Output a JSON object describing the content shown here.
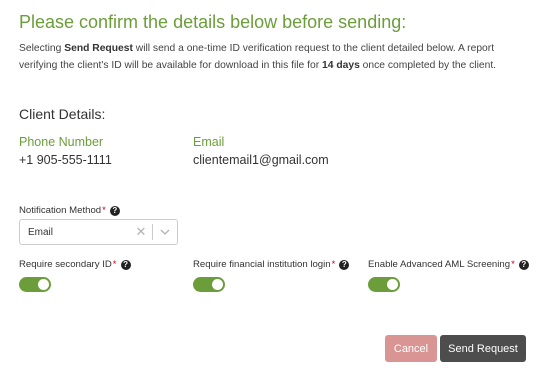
{
  "dialog": {
    "heading": "Please confirm the details below before sending:",
    "intro": {
      "part1": "Selecting ",
      "bold1": "Send Request",
      "part2": " will send a one-time ID verification request to the client detailed below. A report verifying the client's ID will be available for download in this file for ",
      "bold2": "14 days",
      "part3": " once completed by the client."
    }
  },
  "client": {
    "section_title": "Client Details:",
    "phone_label": "Phone Number",
    "phone_value": "+1 905-555-1111",
    "email_label": "Email",
    "email_value": "clientemail1@gmail.com"
  },
  "notification": {
    "label": "Notification Method",
    "required_mark": "*",
    "selected": "Email",
    "clear_icon": "close-icon",
    "arrow_icon": "chevron-down-icon"
  },
  "toggles": [
    {
      "label": "Require secondary ID",
      "required_mark": "*",
      "on": true
    },
    {
      "label": "Require financial institution login",
      "required_mark": "*",
      "on": true
    },
    {
      "label": "Enable Advanced AML Screening",
      "required_mark": "*",
      "on": true
    }
  ],
  "help_glyph": "?",
  "buttons": {
    "cancel": "Cancel",
    "send": "Send Request"
  },
  "colors": {
    "accent_green": "#6b9e3a",
    "required_red": "#d0021b",
    "cancel_bg": "#d99594",
    "send_bg": "#4d4d4d"
  }
}
